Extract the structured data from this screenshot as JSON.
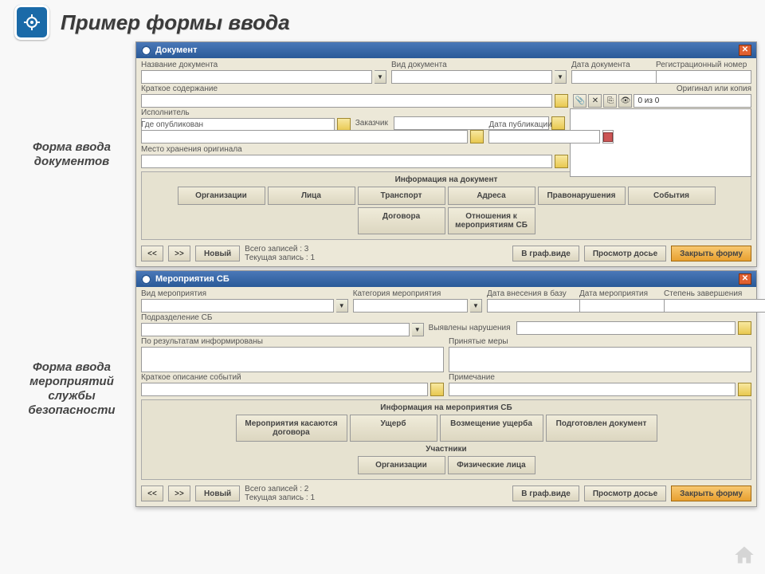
{
  "page": {
    "title": "Пример формы ввода",
    "side_label_1": "Форма ввода документов",
    "side_label_2": "Форма ввода мероприятий службы безопасности"
  },
  "win1": {
    "title": "Документ",
    "labels": {
      "doc_name": "Название документа",
      "doc_type": "Вид документа",
      "doc_date": "Дата документа",
      "reg_no": "Регистрационный номер",
      "summary": "Краткое содержание",
      "orig_copy": "Оригинал или копия",
      "executor": "Исполнитель",
      "customer": "Заказчик",
      "published": "Где опубликован",
      "pub_date": "Дата публикации",
      "storage": "Место хранения оригинала"
    },
    "counter": "0 из 0",
    "group_title": "Информация на документ",
    "tabs": [
      "Организации",
      "Лица",
      "Транспорт",
      "Адреса",
      "Правонарушения",
      "События",
      "Договора",
      "Отношения к мероприятиям СБ"
    ],
    "footer": {
      "prev": "<<",
      "next": ">>",
      "new": "Новый",
      "stat1": "Всего записей : 3",
      "stat2": "Текущая запись : 1",
      "graph": "В граф.виде",
      "dossier": "Просмотр досье",
      "close": "Закрыть форму"
    }
  },
  "win2": {
    "title": "Мероприятия СБ",
    "labels": {
      "evt_type": "Вид мероприятия",
      "evt_cat": "Категория мероприятия",
      "date_base": "Дата внесения в базу",
      "evt_date": "Дата мероприятия",
      "completion": "Степень завершения",
      "dept": "Подразделение СБ",
      "violations": "Выявлены нарушения",
      "informed": "По результатам информированы",
      "measures": "Принятые меры",
      "desc": "Краткое описание событий",
      "note": "Примечание"
    },
    "group1_title": "Информация на мероприятия СБ",
    "tabs1": [
      "Мероприятия касаются договора",
      "Ущерб",
      "Возмещение ущерба",
      "Подготовлен документ"
    ],
    "group2_title": "Участники",
    "tabs2": [
      "Организации",
      "Физические лица"
    ],
    "footer": {
      "prev": "<<",
      "next": ">>",
      "new": "Новый",
      "stat1": "Всего записей : 2",
      "stat2": "Текущая запись : 1",
      "graph": "В граф.виде",
      "dossier": "Просмотр досье",
      "close": "Закрыть форму"
    }
  }
}
